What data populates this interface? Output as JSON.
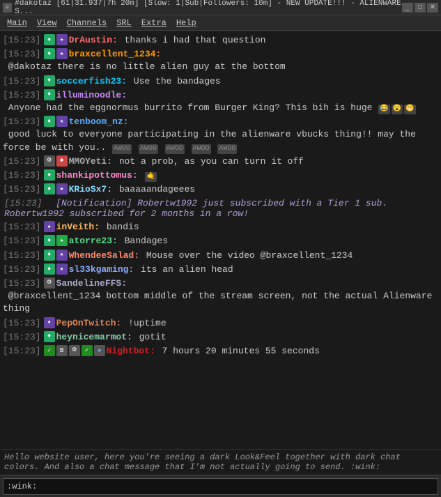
{
  "titlebar": {
    "title": "#dakotaz [61|31.937|7h 20m] [Slow: 1|Sub|Followers: 10m] - NEW UPDATE!!! - ALIENWARE S...",
    "icon": "#",
    "min": "_",
    "max": "□",
    "close": "✕"
  },
  "menubar": {
    "items": [
      "View",
      "Channels",
      "SRL",
      "Extra",
      "Help"
    ],
    "first": "Main"
  },
  "chat": {
    "lines": [
      {
        "id": 1,
        "time": "[15:23]",
        "badges": [
          "subscriber"
        ],
        "username": "DrAustin:",
        "username_class": "c-draustin",
        "message": "thanks i had that question",
        "emotes": []
      },
      {
        "id": 2,
        "time": "[15:23]",
        "badges": [
          "moderator",
          "subscriber"
        ],
        "username": "braxcellent_1234:",
        "username_class": "c-braxcellent",
        "message": "@dakotaz there is no little alien guy at the bottom",
        "emotes": []
      },
      {
        "id": 3,
        "time": "[15:23]",
        "badges": [],
        "username": "soccerfish23:",
        "username_class": "c-soccerfish",
        "message": "Use the bandages",
        "emotes": []
      },
      {
        "id": 4,
        "time": "[15:23]",
        "badges": [],
        "username": "illuminoodle:",
        "username_class": "c-illuminoodle",
        "message": "Anyone had the eggnormus burrito from Burger King? This bih is huge",
        "emotes": [
          "face1",
          "face2",
          "face3"
        ]
      },
      {
        "id": 5,
        "time": "[15:23]",
        "badges": [
          "moderator",
          "subscriber"
        ],
        "username": "tenboom_nz:",
        "username_class": "c-tenboom",
        "message": "good luck to everyone participating in the alienware vbucks thing!! may the force be with you..",
        "emotes": [
          "awoo1",
          "awoo2",
          "awoo3",
          "awoo4",
          "awoo5"
        ]
      },
      {
        "id": 6,
        "time": "[15:23]",
        "badges": [
          "gear",
          "diamond"
        ],
        "username": "MMOYeti:",
        "username_class": "c-mmoyeti",
        "message": "not a prob, as you can turn it off",
        "emotes": []
      },
      {
        "id": 7,
        "time": "[15:23]",
        "badges": [
          "moderator"
        ],
        "username": "shankipottomus:",
        "username_class": "c-shankipottomus",
        "message": "",
        "emotes": [
          "emote1"
        ]
      },
      {
        "id": 8,
        "time": "[15:23]",
        "badges": [
          "moderator",
          "subscriber"
        ],
        "username": "KRioSx7:",
        "username_class": "c-kriosx7",
        "message": "baaaaandageees",
        "emotes": []
      },
      {
        "id": 9,
        "time": "[15:23]",
        "type": "notification",
        "message": "[Notification] Robertw1992 just subscribed with a Tier 1 sub. Robertw1992 subscribed for 2 months in a row!"
      },
      {
        "id": 10,
        "time": "[15:23]",
        "badges": [
          "subscriber"
        ],
        "username": "inVeith:",
        "username_class": "c-inveith",
        "message": "bandis",
        "emotes": []
      },
      {
        "id": 11,
        "time": "[15:23]",
        "badges": [
          "moderator",
          "subscriber_green"
        ],
        "username": "atorre23:",
        "username_class": "c-atorre",
        "message": "Bandages",
        "emotes": []
      },
      {
        "id": 12,
        "time": "[15:23]",
        "badges": [
          "moderator",
          "subscriber"
        ],
        "username": "WhendeeSalad:",
        "username_class": "c-whendee",
        "message": "Mouse over the video @braxcellent_1234",
        "emotes": []
      },
      {
        "id": 13,
        "time": "[15:23]",
        "badges": [
          "moderator",
          "subscriber"
        ],
        "username": "sl33kgaming:",
        "username_class": "c-s133k",
        "message": "its an alien head",
        "emotes": []
      },
      {
        "id": 14,
        "time": "[15:23]",
        "badges": [
          "gear"
        ],
        "username": "SandelineFFS:",
        "username_class": "c-sandeline",
        "message": "@braxcellent_1234 bottom middle of the stream screen, not the actual Alienware thing",
        "emotes": []
      },
      {
        "id": 15,
        "time": "[15:23]",
        "badges": [
          "subscriber"
        ],
        "username": "PepOnTwitch:",
        "username_class": "c-pepon",
        "message": "!uptime",
        "emotes": []
      },
      {
        "id": 16,
        "time": "[15:23]",
        "badges": [
          "moderator"
        ],
        "username": "heynicemarmot:",
        "username_class": "c-heynice",
        "message": "gotit",
        "emotes": []
      },
      {
        "id": 17,
        "time": "[15:23]",
        "badges": [
          "check",
          "bot",
          "gear",
          "check2",
          "bits"
        ],
        "username": "Nightbot:",
        "username_class": "c-nightbot",
        "message": "7 hours 20 minutes 55 seconds",
        "emotes": []
      }
    ],
    "bottom_text": "Hello website user, here you're seeing a dark Look&Feel together with dark chat colors. And also a chat message that I'm not actually going to send. :wink:",
    "input_value": ":wink:"
  }
}
